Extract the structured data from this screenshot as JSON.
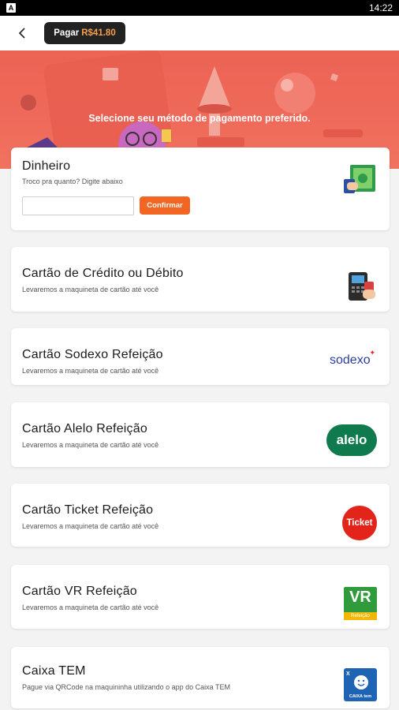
{
  "status_bar": {
    "app_icon_letter": "A",
    "time": "14:22"
  },
  "header": {
    "pay_label": "Pagar",
    "pay_amount": "R$41.80"
  },
  "hero": {
    "text": "Selecione seu método de pagamento preferido."
  },
  "cash": {
    "title": "Dinheiro",
    "subtitle": "Troco pra quanto? Digite abaixo",
    "input_value": "",
    "confirm_label": "Confirmar",
    "icon": "cash-icon"
  },
  "methods": [
    {
      "title": "Cartão de Crédito ou Débito",
      "subtitle": "Levaremos a maquineta de cartão até você",
      "icon": "card-machine-icon"
    },
    {
      "title": "Cartão Sodexo Refeição",
      "subtitle": "Levaremos a maquineta de cartão até você",
      "icon": "sodexo-logo",
      "logo_text": "sodexo"
    },
    {
      "title": "Cartão Alelo Refeição",
      "subtitle": "Levaremos a maquineta de cartão até você",
      "icon": "alelo-logo",
      "logo_text": "alelo"
    },
    {
      "title": "Cartão Ticket Refeição",
      "subtitle": "Levaremos a maquineta de cartão até você",
      "icon": "ticket-logo",
      "logo_text": "Ticket"
    },
    {
      "title": "Cartão VR Refeição",
      "subtitle": "Levaremos a maquineta de cartão até você",
      "icon": "vr-logo",
      "logo_text": "VR",
      "logo_subtext": "Refeição"
    },
    {
      "title": "Caixa TEM",
      "subtitle": "Pague via QRCode na maquininha utilizando o app do Caixa TEM",
      "icon": "caixa-tem-logo",
      "logo_text": "CAIXA tem"
    }
  ],
  "colors": {
    "accent": "#f26522",
    "hero": "#ec6354",
    "dark_button": "#222222",
    "amount": "#f5a04a"
  }
}
